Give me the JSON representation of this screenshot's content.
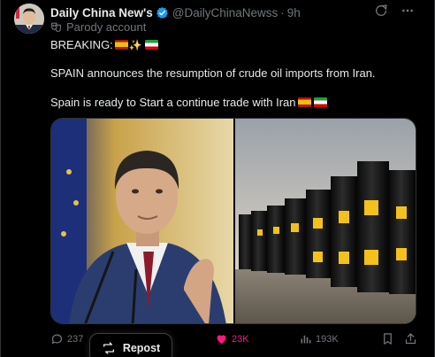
{
  "author": {
    "name": "Daily China New's",
    "handle": "@DailyChinaNewss",
    "separator": "·",
    "time": "9h",
    "label": "Parody account"
  },
  "post": {
    "line1": "BREAKING:",
    "line2": "SPAIN announces the resumption of crude oil imports from Iran.",
    "line3": "Spain is ready to Start a continue trade with Iran"
  },
  "actions": {
    "replies": "237",
    "repost_tooltip": "Repost",
    "likes": "23K",
    "views": "193K"
  },
  "icons": [
    "verified-badge-icon",
    "grok-icon",
    "more-icon",
    "parody-mask-icon",
    "reply-icon",
    "repost-icon",
    "like-icon",
    "views-icon",
    "bookmark-icon",
    "share-icon"
  ],
  "colors": {
    "like_active": "#f91880",
    "verified": "#1d9bf0",
    "muted": "#71767b",
    "background": "#000000"
  }
}
